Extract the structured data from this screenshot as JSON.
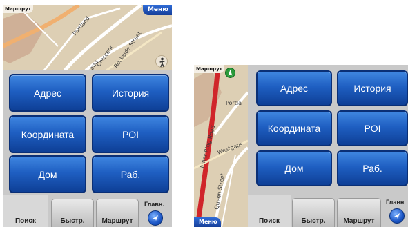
{
  "portrait": {
    "map_tag": "Маршрут",
    "menu_label": "Меню",
    "street_labels": [
      "Portland",
      "Crescent",
      "Rockside Street",
      "and"
    ],
    "buttons": {
      "address": "Адрес",
      "history": "История",
      "coordinate": "Координата",
      "poi": "POI",
      "home": "Дом",
      "work": "Раб."
    },
    "tabs": {
      "search": "Поиск",
      "quick": "Быстр.",
      "route": "Маршрут"
    },
    "main_label": "Главн."
  },
  "landscape": {
    "map_tag": "Маршрут",
    "menu_label": "Меню",
    "street_labels": [
      "Inner Ring Road",
      "Westgate",
      "Queen Street",
      "Portla"
    ],
    "buttons": {
      "address": "Адрес",
      "history": "История",
      "coordinate": "Координата",
      "poi": "POI",
      "home": "Дом",
      "work": "Раб."
    },
    "tabs": {
      "search": "Поиск",
      "quick": "Быстр.",
      "route": "Маршрут"
    },
    "main_label": "Главн"
  },
  "colors": {
    "button_blue": "#1f5fc2",
    "panel_gray": "#c9c9c9",
    "map_bg": "#ddcfb4",
    "route_red": "#d0252a",
    "road_orange": "#f0b070"
  },
  "icons": [
    "compass-icon",
    "pedestrian-icon",
    "navigation-arrow-icon"
  ]
}
